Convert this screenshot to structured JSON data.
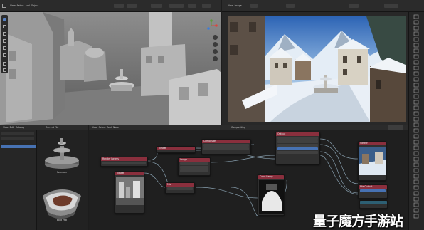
{
  "viewport_header": {
    "menu": [
      "View",
      "Select",
      "Add",
      "Object"
    ],
    "mode": "Object Mode"
  },
  "render_header": {
    "menu": [
      "View",
      "Image"
    ],
    "title": "Render Result"
  },
  "node_header": {
    "menu": [
      "View",
      "Select",
      "Add",
      "Node"
    ],
    "title": "Compositing"
  },
  "asset_header": {
    "menu": [
      "View",
      "Edit",
      "Catalog",
      "Assets"
    ],
    "title": "Current File"
  },
  "assets": [
    {
      "label": "Fountain"
    },
    {
      "label": "Boat Hull"
    }
  ],
  "nodes": {
    "render_layers": {
      "title": "Render Layers"
    },
    "viewer_top": {
      "title": "Viewer"
    },
    "mix": {
      "title": "Mix"
    },
    "composite": {
      "title": "Composite"
    },
    "viewer_left": {
      "title": "Viewer"
    },
    "viewer_right": {
      "title": "Viewer"
    },
    "image": {
      "title": "Image"
    },
    "output_top": {
      "title": "Output"
    },
    "output_bottom": {
      "title": "File Output"
    },
    "color_ramp": {
      "title": "Color Ramp"
    }
  },
  "watermark": "量子魔方手游站",
  "colors": {
    "header_bg": "#2b2b2b",
    "node_red": "#8a2f3d",
    "node_teal": "#2d5f73",
    "link": "#9bb7c9",
    "watermark": "#ffffff"
  }
}
